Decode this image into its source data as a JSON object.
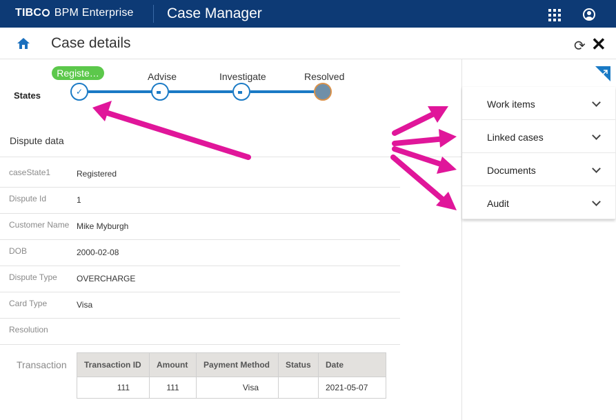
{
  "topbar": {
    "brand_prefix": "TIBC",
    "brand_suffix": " BPM Enterprise",
    "app_title": "Case Manager"
  },
  "subheader": {
    "title": "Case details"
  },
  "states": {
    "label": "States",
    "stages": [
      "Registe…",
      "Advise",
      "Investigate",
      "Resolved"
    ]
  },
  "dispute": {
    "title": "Dispute data",
    "fields": [
      {
        "label": "caseState1",
        "value": "Registered"
      },
      {
        "label": "Dispute Id",
        "value": "1"
      },
      {
        "label": "Customer Name",
        "value": "Mike Myburgh"
      },
      {
        "label": "DOB",
        "value": "2000-02-08"
      },
      {
        "label": "Dispute Type",
        "value": "OVERCHARGE"
      },
      {
        "label": "Card Type",
        "value": "Visa"
      },
      {
        "label": "Resolution",
        "value": ""
      }
    ]
  },
  "transaction": {
    "label": "Transaction",
    "headers": [
      "Transaction ID",
      "Amount",
      "Payment Method",
      "Status",
      "Date"
    ],
    "rows": [
      [
        "111",
        "111",
        "Visa",
        "",
        "2021-05-07"
      ]
    ]
  },
  "panel": {
    "items": [
      "Work items",
      "Linked cases",
      "Documents",
      "Audit"
    ]
  },
  "colors": {
    "topbar": "#0d3a75",
    "accent": "#1a7ac5",
    "pill": "#5cc84b",
    "arrow": "#e0169a"
  }
}
